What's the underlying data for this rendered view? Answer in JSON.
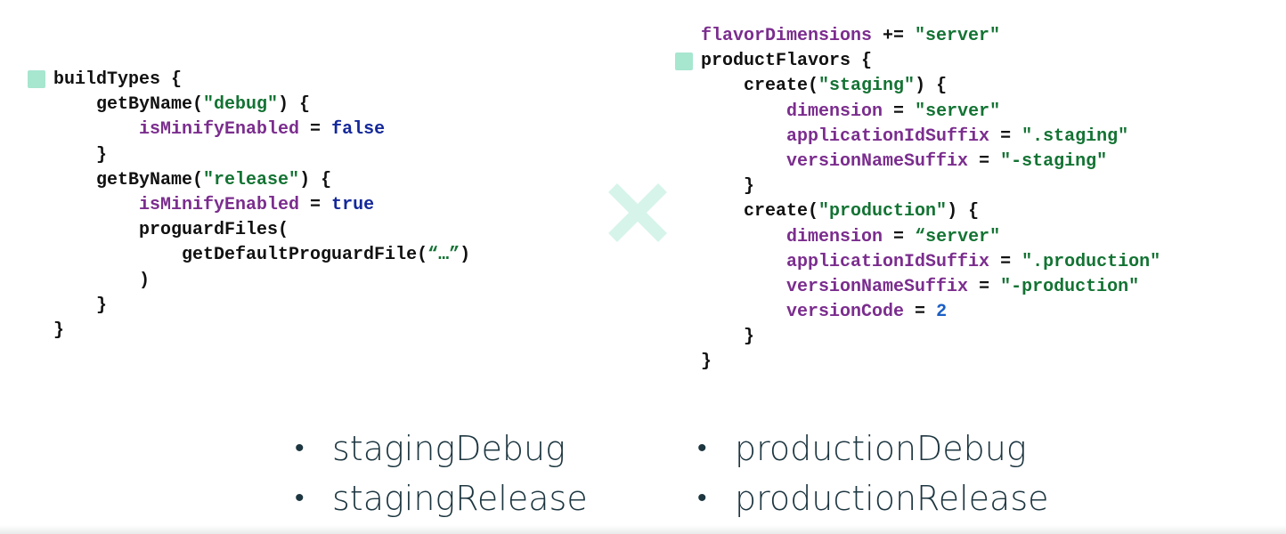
{
  "build_types_code": {
    "lines": [
      [
        {
          "t": "buildTypes {",
          "c": "plain"
        }
      ],
      [
        {
          "t": "    getByName(",
          "c": "plain"
        },
        {
          "t": "\"debug\"",
          "c": "str"
        },
        {
          "t": ") {",
          "c": "plain"
        }
      ],
      [
        {
          "t": "        ",
          "c": "plain"
        },
        {
          "t": "isMinifyEnabled",
          "c": "prop"
        },
        {
          "t": " = ",
          "c": "plain"
        },
        {
          "t": "false",
          "c": "kw"
        }
      ],
      [
        {
          "t": "    }",
          "c": "plain"
        }
      ],
      [
        {
          "t": "    getByName(",
          "c": "plain"
        },
        {
          "t": "\"release\"",
          "c": "str"
        },
        {
          "t": ") {",
          "c": "plain"
        }
      ],
      [
        {
          "t": "        ",
          "c": "plain"
        },
        {
          "t": "isMinifyEnabled",
          "c": "prop"
        },
        {
          "t": " = ",
          "c": "plain"
        },
        {
          "t": "true",
          "c": "kw"
        }
      ],
      [
        {
          "t": "        proguardFiles(",
          "c": "plain"
        }
      ],
      [
        {
          "t": "            getDefaultProguardFile(",
          "c": "plain"
        },
        {
          "t": "“…”",
          "c": "str"
        },
        {
          "t": ")",
          "c": "plain"
        }
      ],
      [
        {
          "t": "        )",
          "c": "plain"
        }
      ],
      [
        {
          "t": "    }",
          "c": "plain"
        }
      ],
      [
        {
          "t": "}",
          "c": "plain"
        }
      ]
    ]
  },
  "product_flavors_code": {
    "lines": [
      [
        {
          "t": "flavorDimensions",
          "c": "prop"
        },
        {
          "t": " += ",
          "c": "plain"
        },
        {
          "t": "\"server\"",
          "c": "str"
        }
      ],
      [
        {
          "t": "productFlavors {",
          "c": "plain"
        }
      ],
      [
        {
          "t": "    create(",
          "c": "plain"
        },
        {
          "t": "\"staging\"",
          "c": "str"
        },
        {
          "t": ") {",
          "c": "plain"
        }
      ],
      [
        {
          "t": "        ",
          "c": "plain"
        },
        {
          "t": "dimension",
          "c": "prop"
        },
        {
          "t": " = ",
          "c": "plain"
        },
        {
          "t": "\"server\"",
          "c": "str"
        }
      ],
      [
        {
          "t": "        ",
          "c": "plain"
        },
        {
          "t": "applicationIdSuffix",
          "c": "prop"
        },
        {
          "t": " = ",
          "c": "plain"
        },
        {
          "t": "\".staging\"",
          "c": "str"
        }
      ],
      [
        {
          "t": "        ",
          "c": "plain"
        },
        {
          "t": "versionNameSuffix",
          "c": "prop"
        },
        {
          "t": " = ",
          "c": "plain"
        },
        {
          "t": "\"-staging\"",
          "c": "str"
        }
      ],
      [
        {
          "t": "    }",
          "c": "plain"
        }
      ],
      [
        {
          "t": "    create(",
          "c": "plain"
        },
        {
          "t": "\"production\"",
          "c": "str"
        },
        {
          "t": ") {",
          "c": "plain"
        }
      ],
      [
        {
          "t": "        ",
          "c": "plain"
        },
        {
          "t": "dimension",
          "c": "prop"
        },
        {
          "t": " = ",
          "c": "plain"
        },
        {
          "t": "“server\"",
          "c": "str"
        }
      ],
      [
        {
          "t": "        ",
          "c": "plain"
        },
        {
          "t": "applicationIdSuffix",
          "c": "prop"
        },
        {
          "t": " = ",
          "c": "plain"
        },
        {
          "t": "\".production\"",
          "c": "str"
        }
      ],
      [
        {
          "t": "        ",
          "c": "plain"
        },
        {
          "t": "versionNameSuffix",
          "c": "prop"
        },
        {
          "t": " = ",
          "c": "plain"
        },
        {
          "t": "\"-production\"",
          "c": "str"
        }
      ],
      [
        {
          "t": "        ",
          "c": "plain"
        },
        {
          "t": "versionCode",
          "c": "prop"
        },
        {
          "t": " = ",
          "c": "plain"
        },
        {
          "t": "2",
          "c": "num"
        }
      ],
      [
        {
          "t": "    }",
          "c": "plain"
        }
      ],
      [
        {
          "t": "}",
          "c": "plain"
        }
      ]
    ]
  },
  "variants": {
    "bullet_glyph": "•",
    "staging": [
      "stagingDebug",
      "stagingRelease"
    ],
    "production": [
      "productionDebug",
      "productionRelease"
    ]
  },
  "icons": {
    "cross": "cross-icon",
    "block_marker": "square-marker-icon"
  },
  "colors": {
    "accent": "#a7e6cf",
    "cross": "#d6f4ea",
    "property": "#7b2d8e",
    "string": "#137333",
    "keyword": "#14289a",
    "number": "#1a5fc4",
    "text": "#111111",
    "bullet_text": "#1d3640"
  }
}
